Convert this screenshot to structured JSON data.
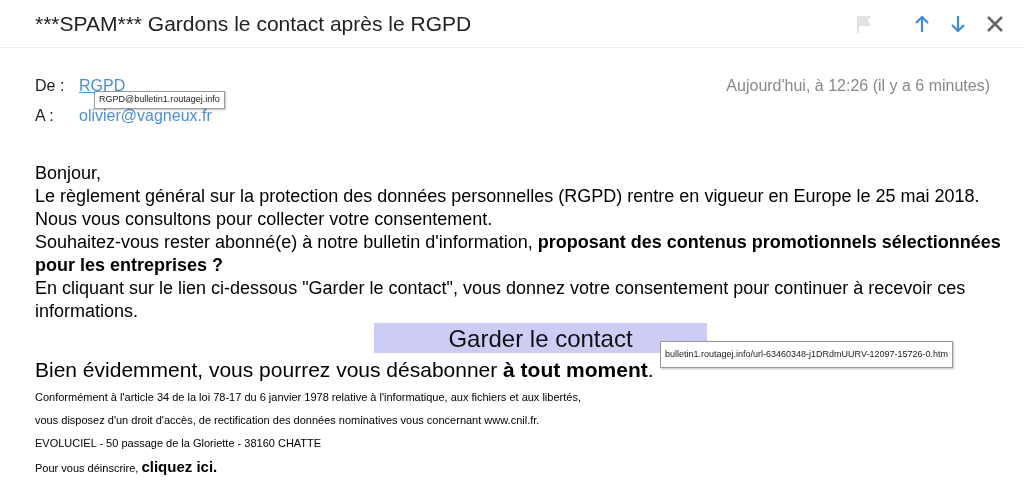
{
  "subject": "***SPAM*** Gardons le contact après le RGPD",
  "toolbar": {
    "flagged": false
  },
  "from": {
    "label": "De :",
    "name": "RGPD",
    "tooltip": "RGPD@bulletin1.routagej.info"
  },
  "to": {
    "label": "A :",
    "address": "olivier@vagneux.fr"
  },
  "date": "Aujourd'hui, à 12:26 (il y a 6 minutes)",
  "body": {
    "paragraphs": [
      "Bonjour,",
      "Le règlement général sur la protection des données personnelles (RGPD) rentre en vigueur en Europe le 25 mai 2018.",
      "Nous vous consultons pour collecter votre consentement.",
      "Souhaitez-vous rester abonné(e) à notre bulletin d'information, **proposant des contenus promotionnels sélectionnées pour les entreprises ?**",
      "En cliquant sur le lien ci-dessous \"Garder le contact\", vous donnez votre consentement pour continuer à recevoir ces informations."
    ],
    "button": {
      "label": "Garder le contact",
      "tooltip": "bulletin1.routagej.info/url-63460348-j1DRdmUURV-12097-15726-0.htm"
    },
    "closing": "Bien évidemment, vous pourrez vous désabonner **à tout moment**.",
    "footer": [
      "Conformément à l'article 34 de la loi 78-17 du 6 janvier 1978 relative à l'informatique, aux fichiers et aux libertés,",
      "vous disposez d'un droit d'accès, de rectification des données nominatives vous concernant www.cnil.fr.",
      "EVOLUCIEL - 50 passage de la Gloriette - 38160 CHATTE"
    ],
    "unsubscribe": {
      "text": "Pour vous déinscrire,",
      "link": "cliquez ici."
    }
  }
}
